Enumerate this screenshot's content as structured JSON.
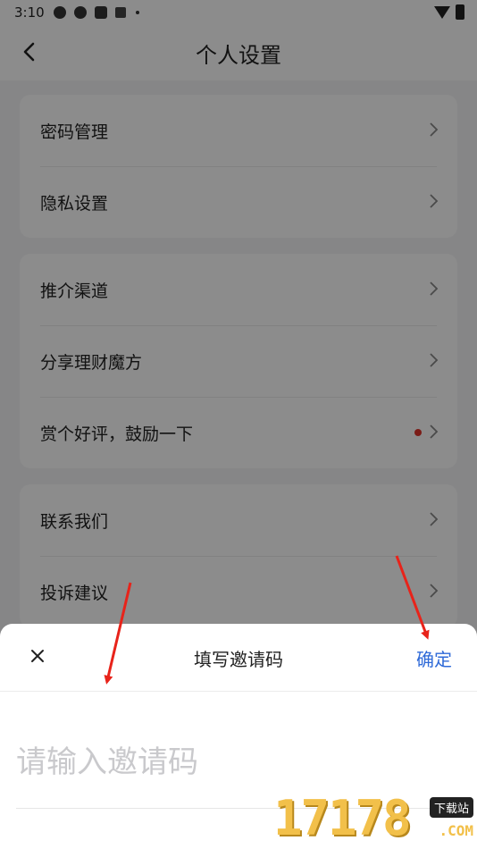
{
  "status_bar": {
    "time": "3:10"
  },
  "header": {
    "title": "个人设置"
  },
  "groups": [
    {
      "items": [
        {
          "label": "密码管理"
        },
        {
          "label": "隐私设置"
        }
      ]
    },
    {
      "items": [
        {
          "label": "推介渠道"
        },
        {
          "label": "分享理财魔方"
        },
        {
          "label": "赏个好评，鼓励一下",
          "has_red_dot": true
        }
      ]
    },
    {
      "items": [
        {
          "label": "联系我们"
        },
        {
          "label": "投诉建议"
        }
      ]
    }
  ],
  "sheet": {
    "title": "填写邀请码",
    "confirm_label": "确定",
    "input": {
      "value": "",
      "placeholder": "请输入邀请码"
    }
  },
  "watermark": {
    "digits": "17178",
    "badge": "下载站",
    "suffix": ".COM"
  },
  "colors": {
    "accent": "#2f6ad8",
    "red_dot": "#e0342b",
    "annotation_arrow": "#e8231a"
  }
}
